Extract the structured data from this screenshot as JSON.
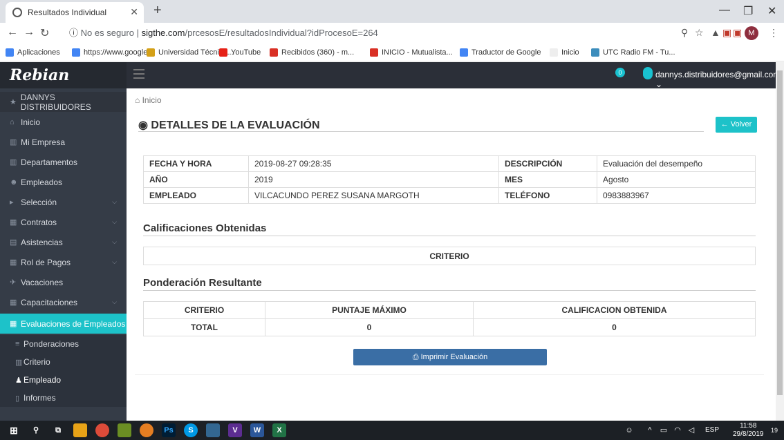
{
  "browser": {
    "tab_title": "Resultados Individual",
    "url_security": "No es seguro",
    "url_domain": "sigthe.com",
    "url_path": "/prcesosE/resultadosIndividual?idProcesoE=264",
    "avatar_letter": "M",
    "bookmarks": [
      "Aplicaciones",
      "https://www.google...",
      "Universidad Técnica...",
      "YouTube",
      "Recibidos (360) - m...",
      "INICIO - Mutualista...",
      "Traductor de Google",
      "Inicio",
      "UTC Radio FM - Tu..."
    ]
  },
  "header": {
    "logo": "Rebian",
    "notification_count": "0",
    "user_email": "dannys.distribuidores@gmail.com ⌄"
  },
  "sidebar": {
    "company": "DANNYS DISTRIBUIDORES",
    "items": [
      {
        "label": "Inicio",
        "icon": "home-icon"
      },
      {
        "label": "Mi Empresa",
        "icon": "bank-icon"
      },
      {
        "label": "Departamentos",
        "icon": "bank-icon"
      },
      {
        "label": "Empleados",
        "icon": "users-icon"
      },
      {
        "label": "Selección",
        "icon": "selection-icon"
      },
      {
        "label": "Contratos",
        "icon": "contracts-icon"
      },
      {
        "label": "Asistencias",
        "icon": "attendance-icon"
      },
      {
        "label": "Rol de Pagos",
        "icon": "table-icon"
      },
      {
        "label": "Vacaciones",
        "icon": "plane-icon"
      },
      {
        "label": "Capacitaciones",
        "icon": "table-icon"
      },
      {
        "label": "Evaluaciones de Empleados",
        "icon": "table-icon"
      }
    ],
    "subitems": [
      {
        "label": "Ponderaciones"
      },
      {
        "label": "Criterio"
      },
      {
        "label": "Empleado"
      },
      {
        "label": "Informes"
      }
    ]
  },
  "main": {
    "breadcrumb": "Inicio",
    "title": "DETALLES DE LA EVALUACIÓN",
    "back_button": "Volver",
    "info": {
      "fecha_label": "FECHA Y HORA",
      "fecha_value": "2019-08-27 09:28:35",
      "desc_label": "DESCRIPCIÓN",
      "desc_value": "Evaluación del desempeño",
      "anio_label": "AÑO",
      "anio_value": "2019",
      "mes_label": "MES",
      "mes_value": "Agosto",
      "emp_label": "EMPLEADO",
      "emp_value": "VILCACUNDO PEREZ SUSANA MARGOTH",
      "tel_label": "TELÉFONO",
      "tel_value": "0983883967"
    },
    "section1_title": "Calificaciones Obtenidas",
    "criterio_header": "CRITERIO",
    "section2_title": "Ponderación Resultante",
    "pond": {
      "h1": "CRITERIO",
      "h2": "PUNTAJE MÁXIMO",
      "h3": "CALIFICACION OBTENIDA",
      "r1": "TOTAL",
      "r2": "0",
      "r3": "0"
    },
    "print_button": "Imprimir Evaluación"
  },
  "taskbar": {
    "lang": "ESP",
    "time": "11:58",
    "date": "29/8/2019",
    "notif": "19"
  }
}
